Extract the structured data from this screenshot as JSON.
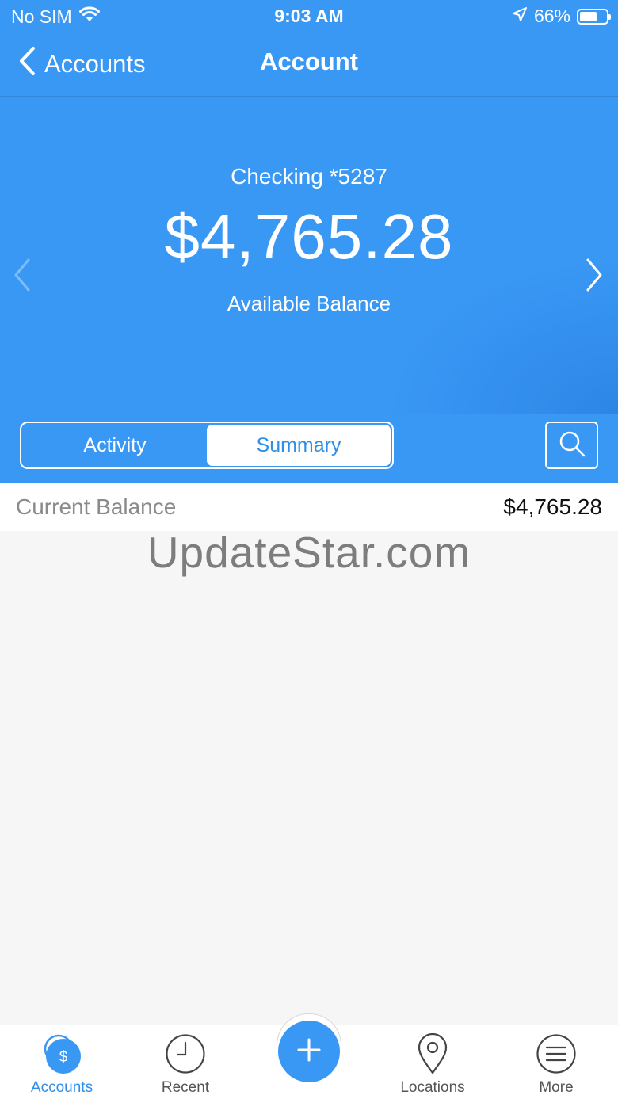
{
  "status_bar": {
    "carrier": "No SIM",
    "time": "9:03 AM",
    "battery": "66%"
  },
  "nav": {
    "back_label": "Accounts",
    "title": "Account"
  },
  "account": {
    "name": "Checking *5287",
    "balance": "$4,765.28",
    "balance_label": "Available Balance"
  },
  "segments": {
    "activity": "Activity",
    "summary": "Summary",
    "selected": "Summary"
  },
  "summary": {
    "current_balance_label": "Current Balance",
    "current_balance_value": "$4,765.28"
  },
  "watermark": "UpdateStar.com",
  "tabs": [
    {
      "label": "Accounts",
      "icon": "dollar-coin-icon",
      "active": true
    },
    {
      "label": "Recent",
      "icon": "clock-icon",
      "active": false
    },
    {
      "label": "",
      "icon": "plus-icon",
      "active": false
    },
    {
      "label": "Locations",
      "icon": "map-pin-icon",
      "active": false
    },
    {
      "label": "More",
      "icon": "hamburger-menu-icon",
      "active": false
    }
  ],
  "colors": {
    "brand_blue": "#3a98f5",
    "active_tab": "#2f8fe8",
    "background": "#f6f6f6"
  }
}
